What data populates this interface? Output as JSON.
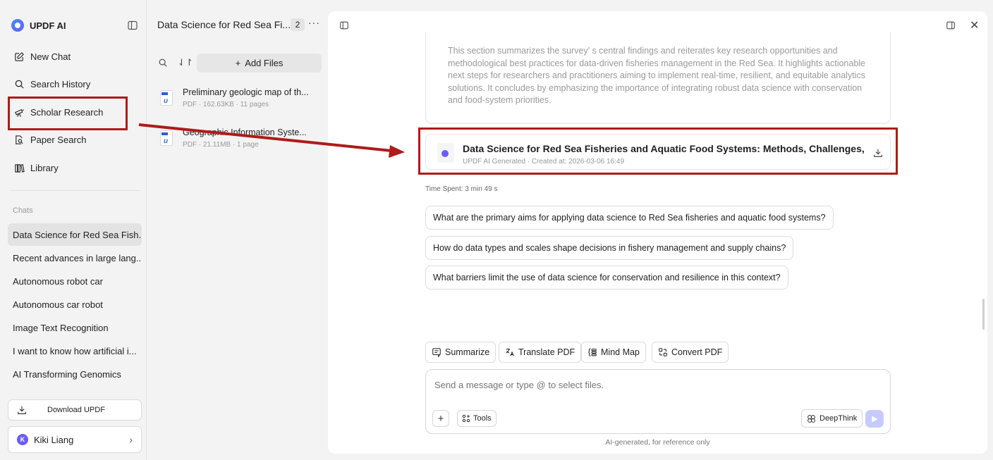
{
  "sidebar": {
    "brand": "UPDF AI",
    "nav": [
      {
        "label": "New Chat",
        "icon": "edit-icon"
      },
      {
        "label": "Search History",
        "icon": "search-icon"
      },
      {
        "label": "Scholar Research",
        "icon": "telescope-icon"
      },
      {
        "label": "Paper Search",
        "icon": "paper-search-icon"
      },
      {
        "label": "Library",
        "icon": "library-icon"
      }
    ],
    "chats_label": "Chats",
    "chats": [
      "Data Science for Red Sea Fish...",
      "Recent advances in large lang...",
      "Autonomous robot car",
      "Autonomous car robot",
      "Image Text Recognition",
      "I want to know how artificial i...",
      "AI Transforming Genomics"
    ],
    "download_label": "Download UPDF",
    "user": {
      "initial": "K",
      "name": "Kiki Liang"
    }
  },
  "files": {
    "title": "Data Science for Red Sea Fi...",
    "count": "2",
    "more": "···",
    "sort_icon": "⇃↾",
    "add_files": "Add Files",
    "items": [
      {
        "name": "Preliminary geologic map of th...",
        "meta": "PDF · 162.63KB · 11 pages"
      },
      {
        "name": "Geographic Information Syste...",
        "meta": "PDF · 21.11MB · 1 page"
      }
    ]
  },
  "main": {
    "summary": "This section summarizes the survey’ s central findings and reiterates key research opportunities and methodological best practices for data-driven fisheries management in the Red Sea. It highlights actionable next steps for researchers and practitioners aiming to implement real-time, resilient, and equitable analytics solutions. It concludes by emphasizing the importance of integrating robust data science with conservation and food-system priorities.",
    "document": {
      "title": "Data Science for Red Sea Fisheries and Aquatic Food Systems: Methods, Challenges,...",
      "meta": "UPDF AI Generated · Created at: 2026-03-06 16:49"
    },
    "time_spent": "Time Spent: 3 min 49 s",
    "suggestions": [
      "What are the primary aims for applying data science to Red Sea fisheries and aquatic food systems?",
      "How do data types and scales shape decisions in fishery management and supply chains?",
      "What barriers limit the use of data science for conservation and resilience in this context?"
    ],
    "tools": [
      {
        "label": "Summarize",
        "icon": "summarize-icon"
      },
      {
        "label": "Translate PDF",
        "icon": "translate-icon"
      },
      {
        "label": "Mind Map",
        "icon": "mind-map-icon"
      },
      {
        "label": "Convert PDF",
        "icon": "convert-icon"
      }
    ],
    "composer": {
      "placeholder": "Send a message or type @ to select files.",
      "tools_label": "Tools",
      "deepthink_label": "DeepThink"
    },
    "footnote": "AI-generated, for reference only"
  },
  "colors": {
    "accent": "#6b5cff",
    "annotation": "#b01a1a"
  }
}
